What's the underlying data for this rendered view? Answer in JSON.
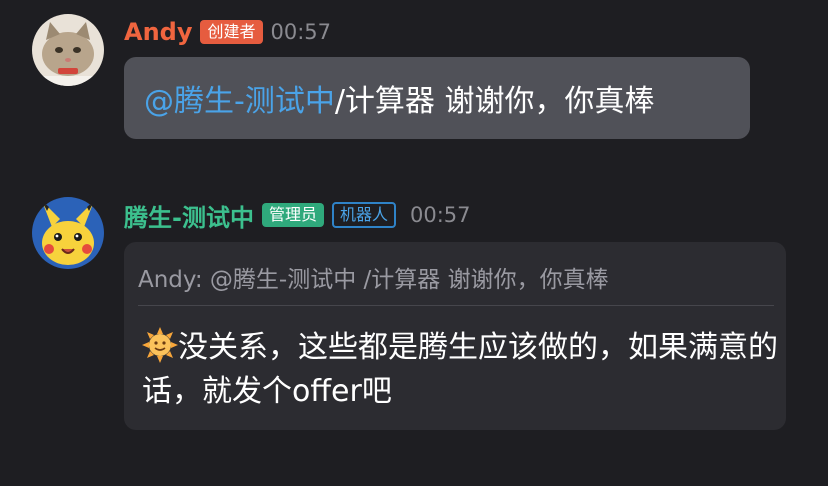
{
  "messages": [
    {
      "author": "Andy",
      "role_badge": "创建者",
      "time": "00:57",
      "text_mention": "@腾生-测试中",
      "text_rest": " /计算器 谢谢你，你真棒",
      "colors": {
        "name": "#f0653f",
        "badge": "#e65c3f",
        "bubble": "#505158"
      }
    },
    {
      "author": "腾生-测试中",
      "role_badge": "管理员",
      "bot_badge": "机器人",
      "time": "00:57",
      "quote": "Andy: @腾生-测试中 /计算器 谢谢你，你真棒",
      "reply_emoji": "sun-face-emoji",
      "reply": "没关系，这些都是腾生应该做的，如果满意的话，就发个offer吧",
      "colors": {
        "name": "#3cc08e",
        "badge": "#2fa97c",
        "bot_badge": "#4aa3e8"
      }
    }
  ],
  "theme": {
    "background": "#1e1e22",
    "mention": "#4aa3e8"
  }
}
